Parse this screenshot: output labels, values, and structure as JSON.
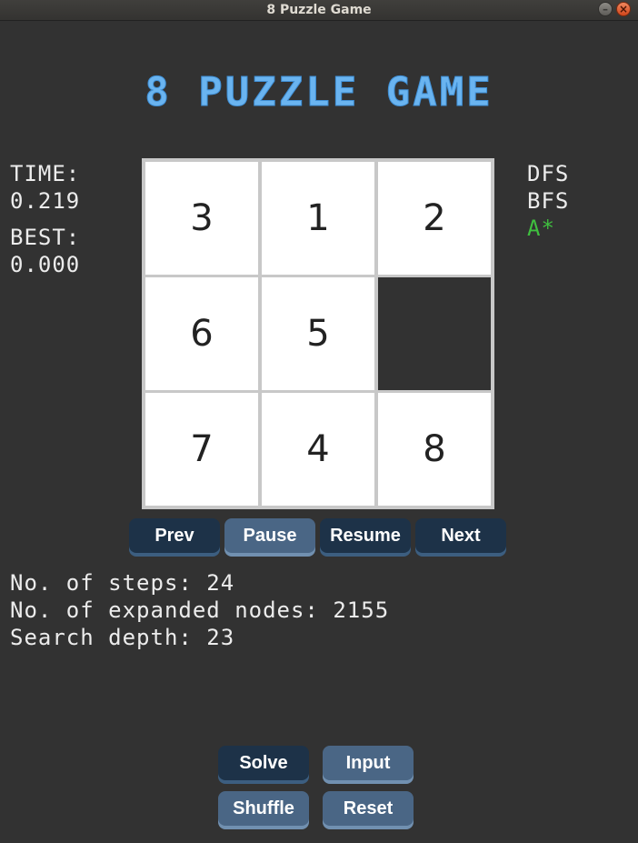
{
  "window": {
    "title": "8 Puzzle Game",
    "minimize_glyph": "–",
    "close_glyph": "×"
  },
  "header": {
    "title": "8 PUZZLE GAME"
  },
  "timer": {
    "time_label": "TIME:",
    "time_value": "0.219",
    "best_label": "BEST:",
    "best_value": "0.000"
  },
  "algorithms": {
    "items": [
      "DFS",
      "BFS",
      "A*"
    ],
    "selected": "A*"
  },
  "board": {
    "tiles": [
      "3",
      "1",
      "2",
      "6",
      "5",
      "",
      "7",
      "4",
      "8"
    ]
  },
  "playback": {
    "prev_label": "Prev",
    "pause_label": "Pause",
    "resume_label": "Resume",
    "next_label": "Next"
  },
  "stats": {
    "steps_label": "No. of steps:",
    "steps_value": "24",
    "expanded_label": "No. of expanded nodes:",
    "expanded_value": "2155",
    "depth_label": "Search depth:",
    "depth_value": "23"
  },
  "controls": {
    "solve_label": "Solve",
    "input_label": "Input",
    "shuffle_label": "Shuffle",
    "reset_label": "Reset"
  },
  "colors": {
    "background": "#323232",
    "title_blue": "#6ab4f0",
    "active_algo": "#3fbf3f",
    "button_dark": "#1d3248",
    "button_light": "#4a6685"
  }
}
